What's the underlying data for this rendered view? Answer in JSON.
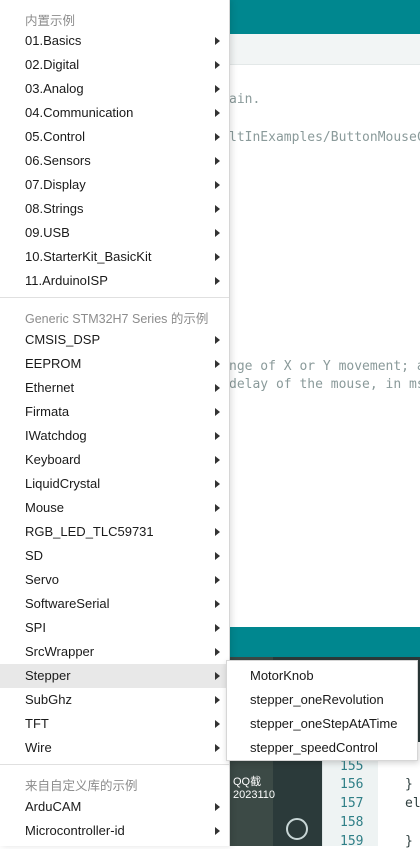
{
  "background": {
    "code_lines": [
      "ain.",
      "ltInExamples/ButtonMouseC",
      "nge of X or Y movement; a",
      "delay of the mouse, in ms"
    ],
    "taskbar_labels": [
      "QQ截",
      "2023110"
    ],
    "line_numbers": [
      "155",
      "156",
      "157",
      "158",
      "159"
    ],
    "code_chars": [
      "}",
      "el",
      "}"
    ]
  },
  "menu": {
    "builtin_header": "内置示例",
    "builtin_items": [
      {
        "label": "01.Basics"
      },
      {
        "label": "02.Digital"
      },
      {
        "label": "03.Analog"
      },
      {
        "label": "04.Communication"
      },
      {
        "label": "05.Control"
      },
      {
        "label": "06.Sensors"
      },
      {
        "label": "07.Display"
      },
      {
        "label": "08.Strings"
      },
      {
        "label": "09.USB"
      },
      {
        "label": "10.StarterKit_BasicKit"
      },
      {
        "label": "11.ArduinoISP"
      }
    ],
    "board_header": "Generic STM32H7 Series 的示例",
    "board_items": [
      {
        "label": "CMSIS_DSP"
      },
      {
        "label": "EEPROM"
      },
      {
        "label": "Ethernet"
      },
      {
        "label": "Firmata"
      },
      {
        "label": "IWatchdog"
      },
      {
        "label": "Keyboard"
      },
      {
        "label": "LiquidCrystal"
      },
      {
        "label": "Mouse"
      },
      {
        "label": "RGB_LED_TLC59731"
      },
      {
        "label": "SD"
      },
      {
        "label": "Servo"
      },
      {
        "label": "SoftwareSerial"
      },
      {
        "label": "SPI"
      },
      {
        "label": "SrcWrapper"
      },
      {
        "label": "Stepper"
      },
      {
        "label": "SubGhz"
      },
      {
        "label": "TFT"
      },
      {
        "label": "Wire"
      }
    ],
    "custom_header": "来自自定义库的示例",
    "custom_items": [
      {
        "label": "ArduCAM"
      },
      {
        "label": "Microcontroller-id"
      }
    ]
  },
  "submenu": {
    "items": [
      {
        "label": "MotorKnob"
      },
      {
        "label": "stepper_oneRevolution"
      },
      {
        "label": "stepper_oneStepAtATime"
      },
      {
        "label": "stepper_speedControl"
      }
    ]
  }
}
